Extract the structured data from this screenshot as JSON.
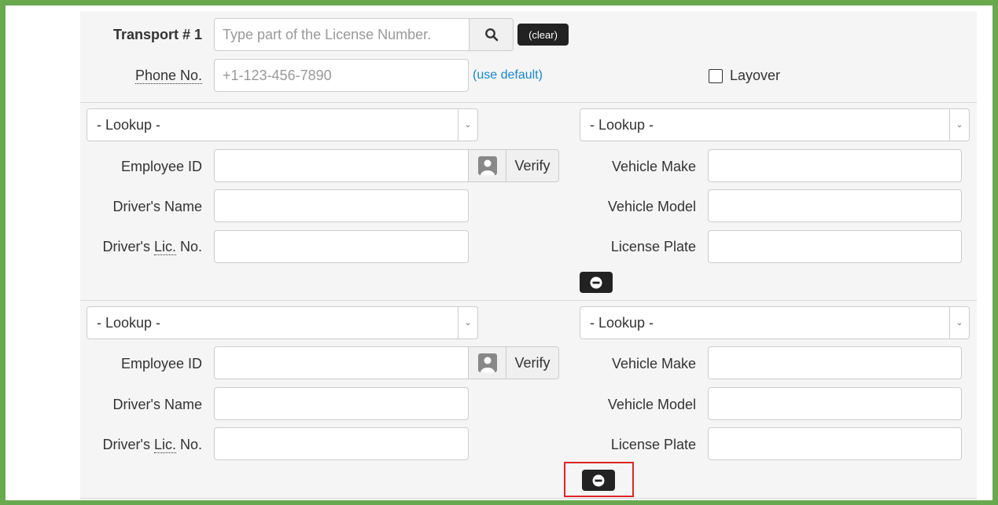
{
  "transport": {
    "label": "Transport # 1",
    "search_placeholder": "Type part of the License Number.",
    "clear_label": "(clear)",
    "phone_label": "Phone No.",
    "phone_placeholder": "+1-123-456-7890",
    "use_default_label": "(use default)",
    "layover_label": "Layover",
    "layover_checked": false
  },
  "drivers": [
    {
      "driver_lookup": "- Lookup -",
      "vehicle_lookup": "- Lookup -",
      "employee_id_label": "Employee ID",
      "verify_label": "Verify",
      "drivers_name_label": "Driver's Name",
      "lic_prefix": "Driver's ",
      "lic_abbr": "Lic.",
      "lic_suffix": " No.",
      "vehicle_make_label": "Vehicle Make",
      "vehicle_model_label": "Vehicle Model",
      "license_plate_label": "License Plate"
    },
    {
      "driver_lookup": "- Lookup -",
      "vehicle_lookup": "- Lookup -",
      "employee_id_label": "Employee ID",
      "verify_label": "Verify",
      "drivers_name_label": "Driver's Name",
      "lic_prefix": "Driver's ",
      "lic_abbr": "Lic.",
      "lic_suffix": " No.",
      "vehicle_make_label": "Vehicle Make",
      "vehicle_model_label": "Vehicle Model",
      "license_plate_label": "License Plate"
    }
  ],
  "icons": {
    "search": "search-icon",
    "user": "user-icon",
    "remove": "minus-circle-icon",
    "dropdown": "chevron-down-icon"
  },
  "colors": {
    "frame": "#6aa84f",
    "highlight": "#e02424",
    "link": "#1a86c8",
    "dark_button": "#222222"
  }
}
